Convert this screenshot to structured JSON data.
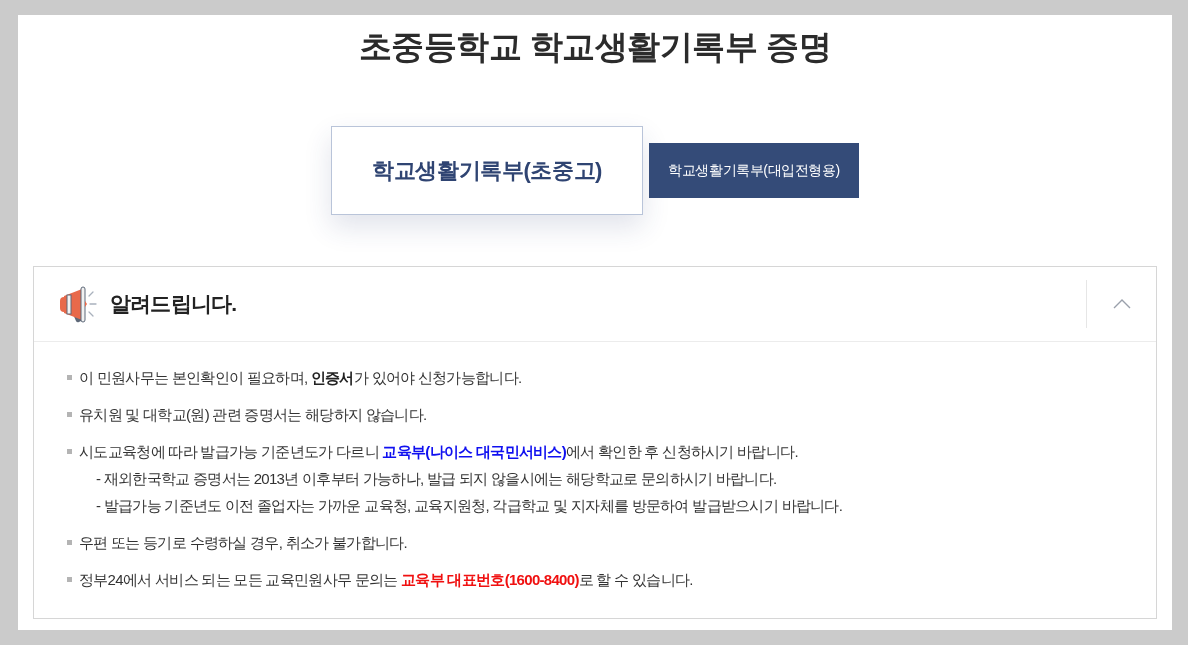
{
  "page": {
    "title": "초중등학교 학교생활기록부 증명"
  },
  "tabs": [
    {
      "label": "학교생활기록부(초중고)",
      "selected": true
    },
    {
      "label": "학교생활기록부(대입전형용)",
      "selected": false
    }
  ],
  "notice": {
    "title": "알려드립니다.",
    "expanded": true,
    "items": [
      {
        "segments": [
          {
            "kind": "text",
            "text": "이 민원사무는 본인확인이 필요하며, **인증서**가 있어야 신청가능합니다."
          }
        ]
      },
      {
        "segments": [
          {
            "kind": "text",
            "text": "유치원 및 대학교(원) 관련 증명서는 해당하지 않습니다."
          }
        ]
      },
      {
        "segments": [
          {
            "kind": "text",
            "text": "시도교육청에 따라 발급가능 기준년도가 다르니 "
          },
          {
            "kind": "link",
            "text": "교육부(나이스 대국민서비스)"
          },
          {
            "kind": "text",
            "text": "에서 확인한 후 신청하시기 바랍니다."
          }
        ],
        "notes": [
          "- 재외한국학교 증명서는 2013년 이후부터 가능하나, 발급 되지 않을시에는 해당학교로 문의하시기 바랍니다.",
          "- 발급가능 기준년도 이전 졸업자는 가까운 교육청, 교육지원청, 각급학교 및 지자체를 방문하여 발급받으시기 바랍니다."
        ]
      },
      {
        "segments": [
          {
            "kind": "text",
            "text": "우편 또는 등기로 수령하실 경우, 취소가 불가합니다."
          }
        ]
      },
      {
        "segments": [
          {
            "kind": "text",
            "text": "정부24에서 서비스 되는 모든 교육민원사무 문의는 "
          },
          {
            "kind": "alert",
            "text": "교육부 대표번호(1600-8400)"
          },
          {
            "kind": "text",
            "text": "로 할 수 있습니다."
          }
        ]
      }
    ]
  }
}
